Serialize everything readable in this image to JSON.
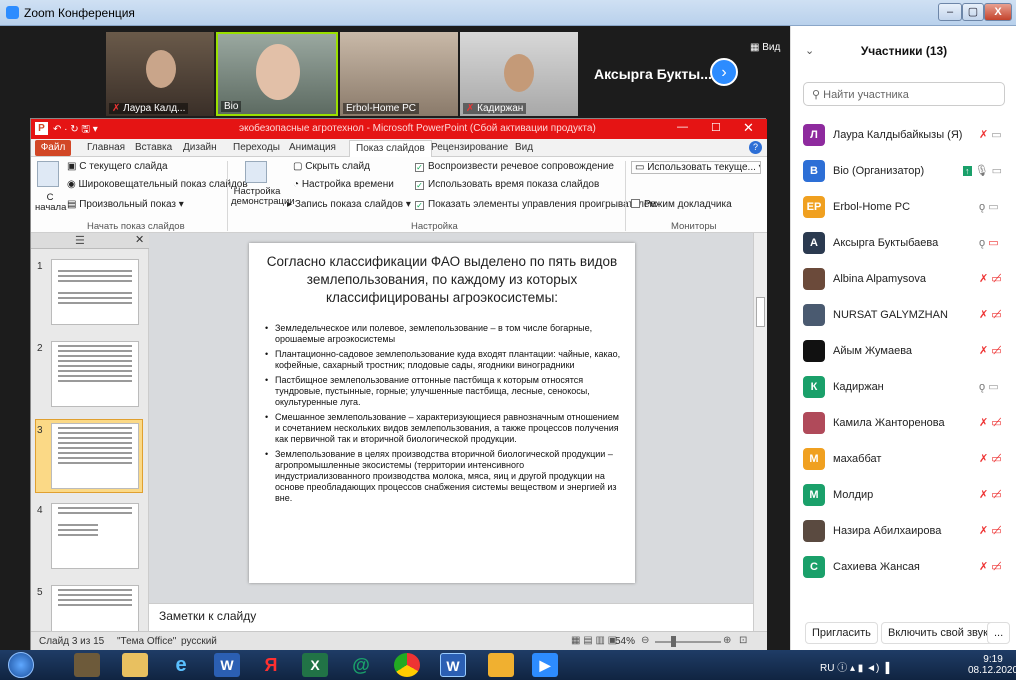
{
  "window": {
    "title": "Zoom Конференция",
    "min": "–",
    "max": "▢",
    "close": "X"
  },
  "videos": [
    {
      "name": "Лаура Калд...",
      "muted": true
    },
    {
      "name": "Bio",
      "muted": false
    },
    {
      "name": "Erbol-Home PC",
      "muted": false
    },
    {
      "name": "Кадиржан",
      "muted": true
    }
  ],
  "active_speaker": "Аксырга Букты...",
  "view_label": "Вид",
  "ppt": {
    "title": "экобезопасные агротехнол  -  Microsoft PowerPoint (Сбой активации продукта)",
    "file_tab": "Файл",
    "tabs": [
      "Главная",
      "Вставка",
      "Дизайн",
      "Переходы",
      "Анимация",
      "Показ слайдов",
      "Рецензирование",
      "Вид"
    ],
    "ribbon": {
      "from_start": "С начала",
      "from_current": "С текущего слайда",
      "broadcast": "Широковещательный показ слайдов",
      "custom": "Произвольный показ",
      "group1": "Начать показ слайдов",
      "setup": "Настройка демонстрации",
      "hide": "Скрыть слайд",
      "rehearse": "Настройка времени",
      "record": "Запись показа слайдов",
      "narration": "Воспроизвести речевое сопровождение",
      "timings": "Использовать время показа слайдов",
      "controls": "Показать элементы управления проигрывателем",
      "group2": "Настройка",
      "use_current": "Использовать текуще...",
      "presenter": "Режим докладчика",
      "group3": "Мониторы"
    },
    "slide_title": "Согласно классификации ФАО выделено по пять видов землепользования, по каждому из которых классифицированы агроэкосистемы:",
    "bullets": [
      "Земледельческое или полевое, землепользование – в том числе богарные, орошаемые агроэкосистемы",
      "Плантационно-садовое землепользование куда входят плантации: чайные, какао, кофейные, сахарный тростник; плодовые сады, ягодники виноградники",
      "Пастбищное землепользование оттонные пастбища к которым относятся тундровые, пустынные, горные; улучшенные пастбища, лесные, сенокосы, окультуренные луга.",
      "Смешанное землепользование – характеризующиеся равнозначным отношением и сочетанием нескольких видов землепользования, а также процессов получения как первичной так и вторичной биологической продукции.",
      "Землепользование в целях производства вторичной биологической продукции – агропромышленные экосистемы (территории интенсивного индустриализованного производства молока, мяса, яиц и другой продукции на основе преобладающих процессов снабжения системы веществом и энергией из вне."
    ],
    "notes": "Заметки к слайду",
    "status": {
      "slide": "Слайд 3 из 15",
      "theme": "\"Тема Office\"",
      "lang": "русский",
      "zoom": "54%"
    },
    "thumb_numbers": [
      "1",
      "2",
      "3",
      "4",
      "5"
    ]
  },
  "participants": {
    "title": "Участники (13)",
    "search_placeholder": "Найти участника",
    "list": [
      {
        "initial": "Л",
        "name": "Лаура Калдыбайкызы (Я)",
        "color": "#8e2a9e"
      },
      {
        "initial": "B",
        "name": "Bio (Организатор)",
        "color": "#2d6fd6"
      },
      {
        "initial": "EP",
        "name": "Erbol-Home PC",
        "color": "#f0a020"
      },
      {
        "initial": "A",
        "name": "Аксырга Буктыбаева",
        "color": "#2b3a50"
      },
      {
        "initial": "",
        "name": "Albina Alpamysova",
        "color": "#6b4a3a"
      },
      {
        "initial": "",
        "name": "NURSAT GALYMZHAN",
        "color": "#4a5a70"
      },
      {
        "initial": "",
        "name": "Айым Жумаева",
        "color": "#111111"
      },
      {
        "initial": "К",
        "name": "Кадиржан",
        "color": "#1aa06a"
      },
      {
        "initial": "",
        "name": "Камила Жанторенова",
        "color": "#b04a5a"
      },
      {
        "initial": "М",
        "name": "махаббат",
        "color": "#f0a020"
      },
      {
        "initial": "M",
        "name": "Молдир",
        "color": "#1aa06a"
      },
      {
        "initial": "",
        "name": "Назира Абилхаирова",
        "color": "#5a4a40"
      },
      {
        "initial": "С",
        "name": "Сахиева Жансая",
        "color": "#1aa06a"
      }
    ],
    "invite": "Пригласить",
    "unmute": "Включить свой звук",
    "more": "..."
  },
  "taskbar": {
    "lang": "RU",
    "time": "9:19",
    "date": "08.12.2020"
  }
}
